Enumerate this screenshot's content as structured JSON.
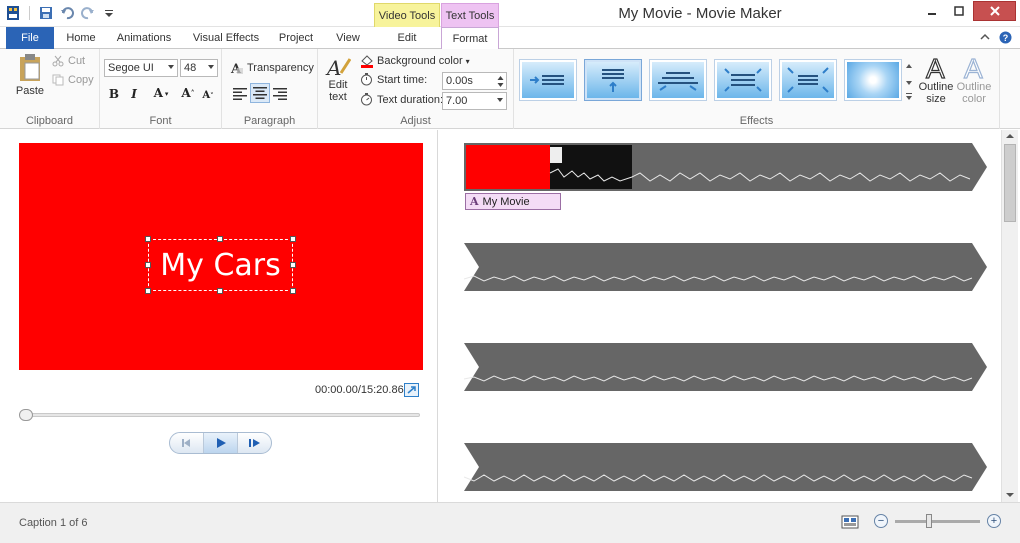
{
  "window": {
    "title": "My Movie - Movie Maker",
    "context_video": "Video Tools",
    "context_text": "Text Tools"
  },
  "tabs": {
    "file": "File",
    "home": "Home",
    "animations": "Animations",
    "visual_effects": "Visual Effects",
    "project": "Project",
    "view": "View",
    "edit": "Edit",
    "format": "Format"
  },
  "ribbon": {
    "clipboard": {
      "label": "Clipboard",
      "paste": "Paste",
      "cut": "Cut",
      "copy": "Copy"
    },
    "font": {
      "label": "Font",
      "family": "Segoe UI",
      "size": "48"
    },
    "paragraph": {
      "label": "Paragraph",
      "transparency": "Transparency"
    },
    "adjust": {
      "label": "Adjust",
      "edit_text_1": "Edit",
      "edit_text_2": "text",
      "background_color": "Background color",
      "start_time_label": "Start time:",
      "start_time_value": "0.00s",
      "duration_label": "Text duration:",
      "duration_value": "7.00"
    },
    "effects": {
      "label": "Effects",
      "outline_size": "Outline size",
      "outline_color": "Outline color"
    }
  },
  "preview": {
    "caption_text": "My Cars",
    "timecode": "00:00.00/15:20.86",
    "background_color": "#ff0000"
  },
  "storyboard": {
    "caption_chip": "My Movie",
    "caption_chip_icon": "A"
  },
  "status": {
    "text": "Caption 1 of 6",
    "zoom_out": "−",
    "zoom_in": "+"
  }
}
